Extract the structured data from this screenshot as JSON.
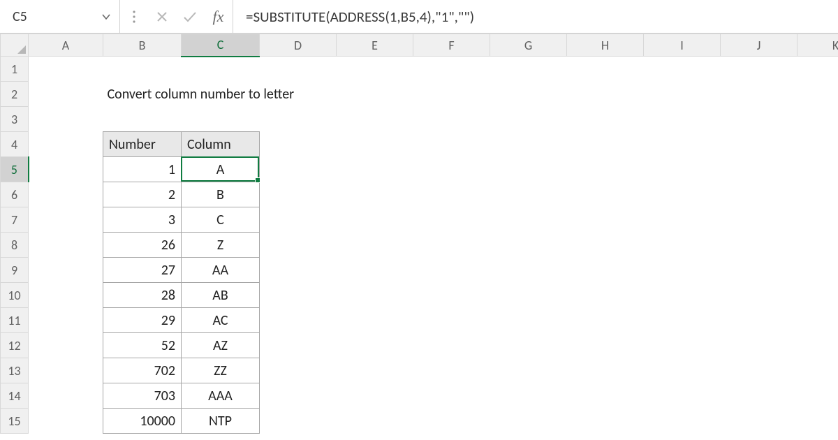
{
  "name_box": "C5",
  "formula": "=SUBSTITUTE(ADDRESS(1,B5,4),\"1\",\"\")",
  "fx_label": "fx",
  "columns": [
    "A",
    "B",
    "C",
    "D",
    "E",
    "F",
    "G",
    "H",
    "I",
    "J",
    "K"
  ],
  "rows": [
    "1",
    "2",
    "3",
    "4",
    "5",
    "6",
    "7",
    "8",
    "9",
    "10",
    "11",
    "12",
    "13",
    "14",
    "15"
  ],
  "title": "Convert column number to letter",
  "table": {
    "header_number": "Number",
    "header_column": "Column",
    "rows": [
      {
        "n": "1",
        "c": "A"
      },
      {
        "n": "2",
        "c": "B"
      },
      {
        "n": "3",
        "c": "C"
      },
      {
        "n": "26",
        "c": "Z"
      },
      {
        "n": "27",
        "c": "AA"
      },
      {
        "n": "28",
        "c": "AB"
      },
      {
        "n": "29",
        "c": "AC"
      },
      {
        "n": "52",
        "c": "AZ"
      },
      {
        "n": "702",
        "c": "ZZ"
      },
      {
        "n": "703",
        "c": "AAA"
      },
      {
        "n": "10000",
        "c": "NTP"
      }
    ]
  },
  "active": {
    "col_index": 3,
    "row_index": 5
  }
}
